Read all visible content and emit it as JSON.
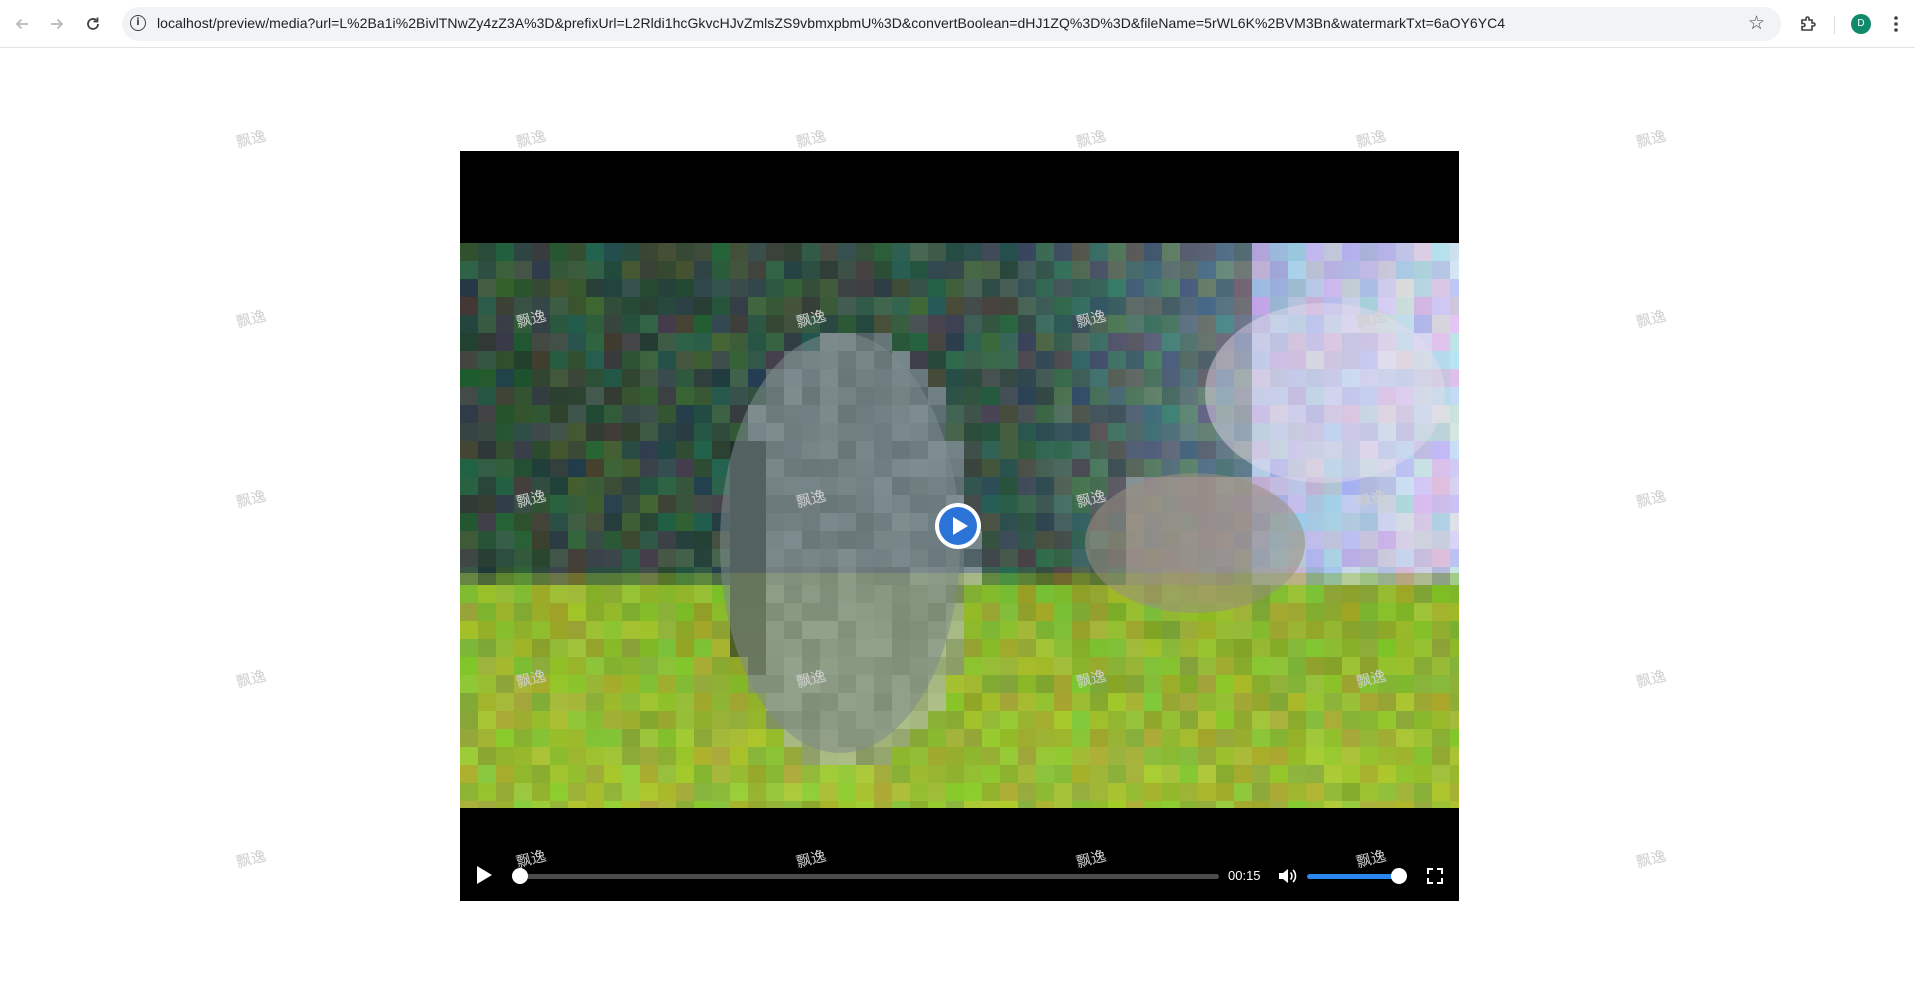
{
  "browser": {
    "url": "localhost/preview/media?url=L%2Ba1i%2BivlTNwZy4zZ3A%3D&prefixUrl=L2Rldi1hcGkvcHJvZmlsZS9vbmxpbmU%3D&convertBoolean=dHJ1ZQ%3D%3D&fileName=5rWL6K%2BVM3Bn&watermarkTxt=6aOY6YC4",
    "profile_initial": "D",
    "icons": {
      "back": "back-arrow-icon",
      "forward": "forward-arrow-icon",
      "reload": "reload-icon",
      "site_info": "info-icon",
      "bookmark": "star-icon",
      "extensions": "puzzle-icon",
      "menu": "kebab-menu-icon"
    }
  },
  "watermark": {
    "text": "飘逸",
    "color": "#cfcfcf"
  },
  "player": {
    "current_time": "00:15",
    "progress_fraction": 0.0,
    "volume_fraction": 1.0,
    "accent_color": "#2b87f0",
    "center_button_color": "#2b73d7",
    "icons": {
      "center": "play-circle-icon",
      "play": "play-icon",
      "volume": "volume-icon",
      "fullscreen": "fullscreen-icon"
    }
  }
}
